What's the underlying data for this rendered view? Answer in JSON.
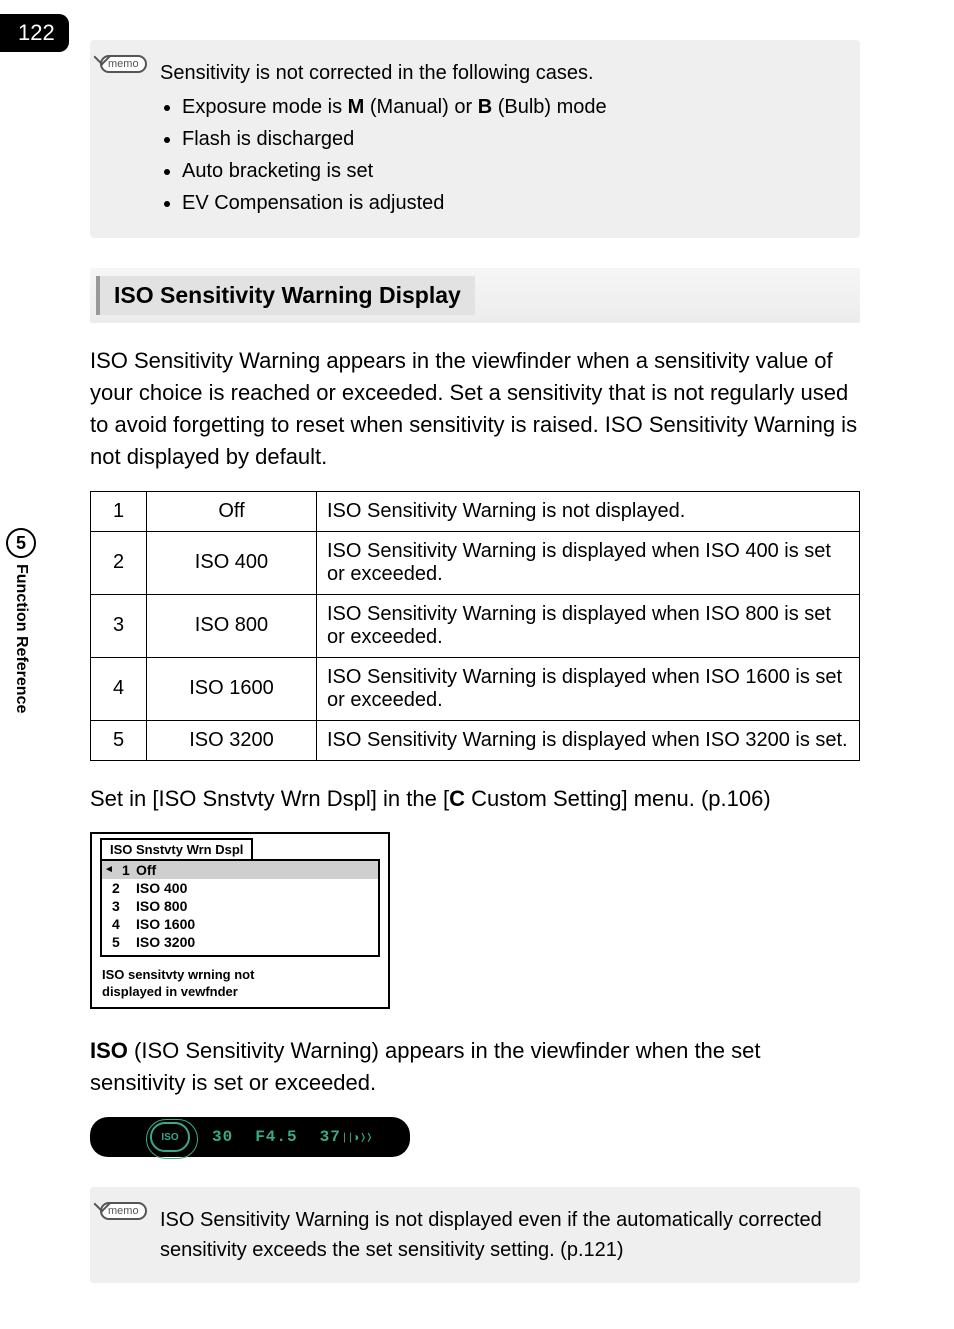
{
  "page_number": "122",
  "side_tab": {
    "number": "5",
    "label": "Function Reference"
  },
  "memo_icon_label": "memo",
  "memo1": {
    "intro": "Sensitivity is not corrected in the following cases.",
    "bullets_prefix": "• ",
    "bullet1_pre": "Exposure mode is ",
    "bullet1_m": "M",
    "bullet1_mid": " (Manual) or ",
    "bullet1_b": "B",
    "bullet1_post": " (Bulb) mode",
    "bullet2": "Flash is discharged",
    "bullet3": "Auto bracketing is set",
    "bullet4": "EV Compensation is adjusted"
  },
  "heading": "ISO Sensitivity Warning Display",
  "intro_para": "ISO Sensitivity Warning appears in the viewfinder when a sensitivity value of your choice is reached or exceeded. Set a sensitivity that is not regularly used to avoid forgetting to reset when sensitivity is raised. ISO Sensitivity Warning is not displayed by default.",
  "table": {
    "rows": [
      {
        "n": "1",
        "label": "Off",
        "desc": "ISO Sensitivity Warning is not displayed."
      },
      {
        "n": "2",
        "label": "ISO 400",
        "desc": "ISO Sensitivity Warning is displayed when ISO 400 is set or exceeded."
      },
      {
        "n": "3",
        "label": "ISO 800",
        "desc": "ISO Sensitivity Warning is displayed when ISO 800 is set or exceeded."
      },
      {
        "n": "4",
        "label": "ISO 1600",
        "desc": "ISO Sensitivity Warning is displayed when ISO 1600 is set or exceeded."
      },
      {
        "n": "5",
        "label": "ISO 3200",
        "desc": "ISO Sensitivity Warning is displayed when ISO 3200 is set."
      }
    ]
  },
  "set_line_pre": "Set in [ISO Snstvty Wrn Dspl] in the [",
  "set_line_c": "C",
  "set_line_post": " Custom Setting] menu. (p.106)",
  "menu": {
    "tab": "ISO Snstvty Wrn Dspl",
    "rows": [
      {
        "n": "1",
        "label": "Off",
        "selected": true
      },
      {
        "n": "2",
        "label": "ISO 400",
        "selected": false
      },
      {
        "n": "3",
        "label": "ISO 800",
        "selected": false
      },
      {
        "n": "4",
        "label": "ISO 1600",
        "selected": false
      },
      {
        "n": "5",
        "label": "ISO 3200",
        "selected": false
      }
    ],
    "help1": "ISO sensitvty wrning not",
    "help2": "displayed in vewfnder"
  },
  "iso_line_bold": "ISO",
  "iso_line_rest": " (ISO Sensitivity Warning) appears in the viewfinder when the set sensitivity is set or exceeded.",
  "viewfinder": {
    "iso_label": "ISO",
    "v1": "30",
    "v2": "F4.5",
    "v3": "37",
    "bars": "❘❘◗❭❭"
  },
  "memo2": "ISO Sensitivity Warning is not displayed even if the automatically corrected sensitivity exceeds the set sensitivity setting. (p.121)"
}
